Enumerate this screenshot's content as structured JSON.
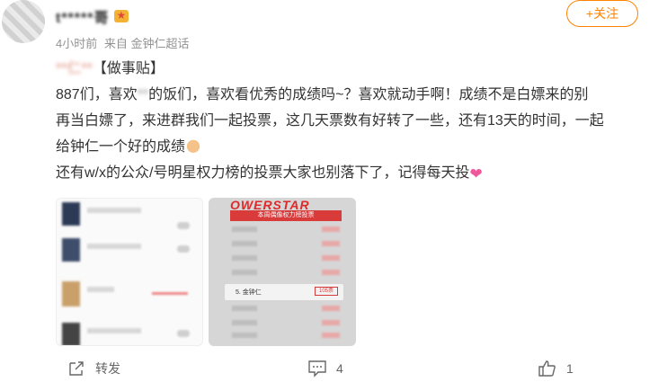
{
  "author": {
    "name": "t*****哥",
    "meta_time": "4小时前",
    "meta_source": "来自 金钟仁超话"
  },
  "follow_button": "+关注",
  "post": {
    "line1_prefix": "**仁**",
    "line1_tag": "【做事贴】",
    "line2": "887们，喜欢",
    "line2_blur": "**",
    "line2_rest": "的饭们，喜欢看优秀的成绩吗~？喜欢就动手啊！成绩不是白嫖来的别",
    "line3": "再当白嫖了，来进群我们一起投票，这几天票数有好转了一些，还有13天的时间，一起",
    "line4": "给钟仁一个好的成绩",
    "line5": "还有w/x的公众/号明星权力榜的投票大家也别落下了，记得每天投"
  },
  "images": {
    "thumb2_banner": "OWERSTAR",
    "thumb2_ribbon": "本周偶像权力榜投票",
    "thumb2_rank": "5. 金钟仁",
    "thumb2_value": "105票"
  },
  "actions": {
    "share_label": "转发",
    "comment_count": "4",
    "like_count": "1"
  },
  "icons": {
    "share": "share-icon",
    "comment": "comment-icon",
    "like": "thumbs-up-icon"
  },
  "colors": {
    "accent": "#ff8200",
    "link_red": "#e02a2a"
  }
}
